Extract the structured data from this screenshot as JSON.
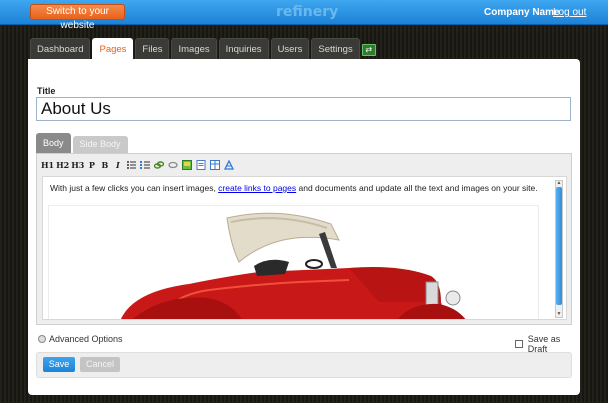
{
  "topbar": {
    "switch_label": "Switch to your website",
    "logo": "refinery",
    "company": "Company Name",
    "logout": "Log out"
  },
  "tabs": [
    {
      "label": "Dashboard"
    },
    {
      "label": "Pages"
    },
    {
      "label": "Files"
    },
    {
      "label": "Images"
    },
    {
      "label": "Inquiries"
    },
    {
      "label": "Users"
    },
    {
      "label": "Settings"
    }
  ],
  "form": {
    "title_label": "Title",
    "title_value": "About Us",
    "part_tabs": [
      "Body",
      "Side Body"
    ],
    "toolbar": [
      "H1",
      "H2",
      "H3",
      "P",
      "B",
      "I"
    ],
    "body_before": "With just a few clicks you can insert images, ",
    "body_link": "create links to pages",
    "body_after": " and documents and update all the text and images on your site.",
    "advanced_options": "Advanced Options",
    "save_draft": "Save as Draft",
    "save": "Save",
    "cancel": "Cancel"
  },
  "colors": {
    "accent_blue": "#1c82d6",
    "accent_orange": "#e8621c"
  }
}
